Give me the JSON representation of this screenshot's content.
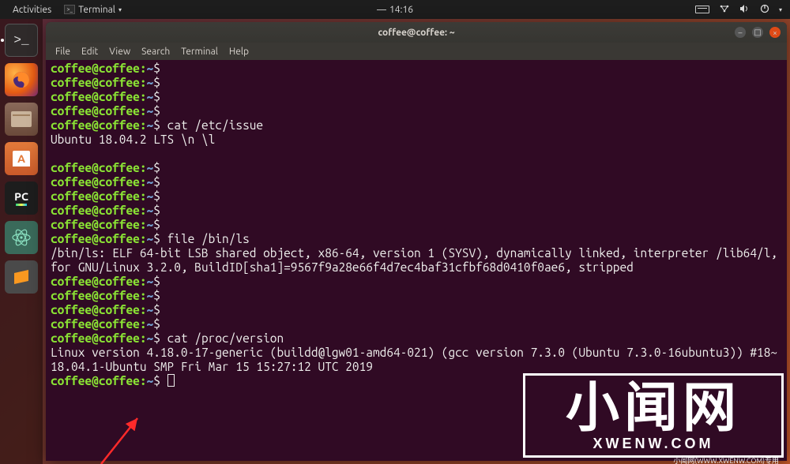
{
  "topbar": {
    "activities": "Activities",
    "app_label": "Terminal",
    "time": "14:16",
    "time_dash": "—"
  },
  "dock": {
    "items": [
      {
        "name": "terminal",
        "running": true
      },
      {
        "name": "firefox"
      },
      {
        "name": "files"
      },
      {
        "name": "software"
      },
      {
        "name": "pycharm"
      },
      {
        "name": "atom"
      },
      {
        "name": "sublime"
      }
    ],
    "pycharm_label": "PC"
  },
  "window": {
    "title": "coffee@coffee: ~",
    "menus": [
      "File",
      "Edit",
      "View",
      "Search",
      "Terminal",
      "Help"
    ],
    "buttons": {
      "min": "–",
      "max": "□",
      "close": "×"
    }
  },
  "terminal": {
    "prompt_user": "coffee@coffee",
    "prompt_sep1": ":",
    "prompt_path": "~",
    "prompt_sep2": "$",
    "lines": [
      {
        "type": "prompt",
        "cmd": ""
      },
      {
        "type": "prompt",
        "cmd": ""
      },
      {
        "type": "prompt",
        "cmd": ""
      },
      {
        "type": "prompt",
        "cmd": ""
      },
      {
        "type": "prompt",
        "cmd": "cat /etc/issue"
      },
      {
        "type": "out",
        "text": "Ubuntu 18.04.2 LTS \\n \\l"
      },
      {
        "type": "blank"
      },
      {
        "type": "prompt",
        "cmd": ""
      },
      {
        "type": "prompt",
        "cmd": ""
      },
      {
        "type": "prompt",
        "cmd": ""
      },
      {
        "type": "prompt",
        "cmd": ""
      },
      {
        "type": "prompt",
        "cmd": ""
      },
      {
        "type": "prompt",
        "cmd": "file /bin/ls"
      },
      {
        "type": "out",
        "text": "/bin/ls: ELF 64-bit LSB shared object, x86-64, version 1 (SYSV), dynamically linked, interpreter /lib64/l, for GNU/Linux 3.2.0, BuildID[sha1]=9567f9a28e66f4d7ec4baf31cfbf68d0410f0ae6, stripped"
      },
      {
        "type": "prompt",
        "cmd": ""
      },
      {
        "type": "prompt",
        "cmd": ""
      },
      {
        "type": "prompt",
        "cmd": ""
      },
      {
        "type": "prompt",
        "cmd": ""
      },
      {
        "type": "prompt",
        "cmd": "cat /proc/version"
      },
      {
        "type": "out",
        "text": "Linux version 4.18.0-17-generic (buildd@lgw01-amd64-021) (gcc version 7.3.0 (Ubuntu 7.3.0-16ubuntu3)) #18~18.04.1-Ubuntu SMP Fri Mar 15 15:27:12 UTC 2019"
      },
      {
        "type": "prompt",
        "cmd": "",
        "cursor": true
      }
    ]
  },
  "watermark": {
    "big": "小闻网",
    "small": "XWENW.COM",
    "side": "XWENW.COM",
    "foot": "小闻网(WWW.XWENW.COM)专用"
  }
}
